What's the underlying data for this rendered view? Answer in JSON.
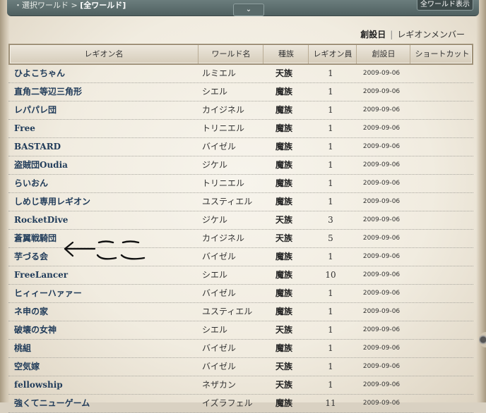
{
  "header": {
    "breadcrumb_prefix": "・選択ワールド > ",
    "breadcrumb_current": "[全ワールド]",
    "all_world_button": "全ワールド表示",
    "toggle_glyph": "⌄"
  },
  "sort": {
    "active": "創設日",
    "separator": "|",
    "other": "レギオンメンバー"
  },
  "table": {
    "headers": [
      "レギオン名",
      "ワールド名",
      "種族",
      "レギオン員",
      "創設日",
      "ショートカット"
    ],
    "rows": [
      {
        "name": "ひよこちゃん",
        "world": "ルミエル",
        "race": "天族",
        "members": "1",
        "date": "2009-09-06"
      },
      {
        "name": "直角二等辺三角形",
        "world": "シエル",
        "race": "魔族",
        "members": "1",
        "date": "2009-09-06"
      },
      {
        "name": "レパパレ団",
        "world": "カイジネル",
        "race": "魔族",
        "members": "1",
        "date": "2009-09-06"
      },
      {
        "name": "Free",
        "world": "トリニエル",
        "race": "魔族",
        "members": "1",
        "date": "2009-09-06"
      },
      {
        "name": "BASTARD",
        "world": "バイゼル",
        "race": "魔族",
        "members": "1",
        "date": "2009-09-06"
      },
      {
        "name": "盗賊団Oudia",
        "world": "ジケル",
        "race": "魔族",
        "members": "1",
        "date": "2009-09-06"
      },
      {
        "name": "らいおん",
        "world": "トリニエル",
        "race": "魔族",
        "members": "1",
        "date": "2009-09-06"
      },
      {
        "name": "しめじ専用レギオン",
        "world": "ユスティエル",
        "race": "魔族",
        "members": "1",
        "date": "2009-09-06"
      },
      {
        "name": "RocketDive",
        "world": "ジケル",
        "race": "天族",
        "members": "3",
        "date": "2009-09-06"
      },
      {
        "name": "蒼翼戦騎団",
        "world": "カイジネル",
        "race": "天族",
        "members": "5",
        "date": "2009-09-06"
      },
      {
        "name": "芋づる会",
        "world": "バイゼル",
        "race": "魔族",
        "members": "1",
        "date": "2009-09-06"
      },
      {
        "name": "FreeLancer",
        "world": "シエル",
        "race": "魔族",
        "members": "10",
        "date": "2009-09-06"
      },
      {
        "name": "ヒィィーハァァー",
        "world": "バイゼル",
        "race": "魔族",
        "members": "1",
        "date": "2009-09-06"
      },
      {
        "name": "ネ申の家",
        "world": "ユスティエル",
        "race": "魔族",
        "members": "1",
        "date": "2009-09-06"
      },
      {
        "name": "破壊の女神",
        "world": "シエル",
        "race": "天族",
        "members": "1",
        "date": "2009-09-06"
      },
      {
        "name": "桃組",
        "world": "バイゼル",
        "race": "魔族",
        "members": "1",
        "date": "2009-09-06"
      },
      {
        "name": "空気嫁",
        "world": "バイゼル",
        "race": "天族",
        "members": "1",
        "date": "2009-09-06"
      },
      {
        "name": "fellowship",
        "world": "ネザカン",
        "race": "天族",
        "members": "1",
        "date": "2009-09-06"
      },
      {
        "name": "強くてニューゲーム",
        "world": "イズラフェル",
        "race": "魔族",
        "members": "11",
        "date": "2009-09-06"
      }
    ]
  },
  "annotation": {
    "text": "ここ",
    "pointer": "arrow-left-icon"
  },
  "colors": {
    "name_link": "#213c5a",
    "topbar": "#5b6c6c",
    "border": "#a0927a"
  }
}
